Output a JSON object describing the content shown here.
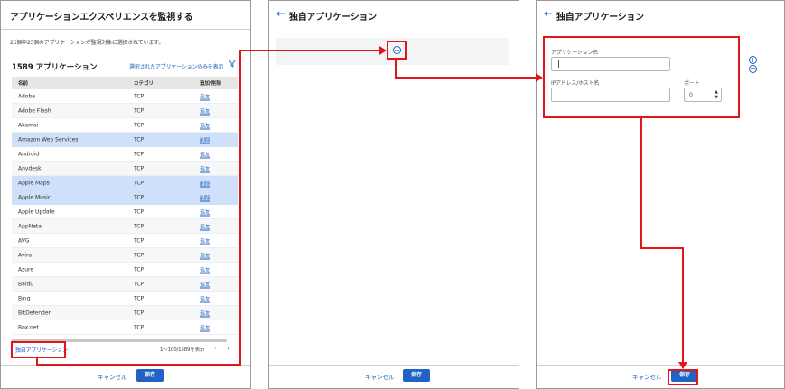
{
  "panel1": {
    "title": "アプリケーションエクスペリエンスを監視する",
    "monitored_note": "25個中23個のアプリケーションが監視対象に選択されています。",
    "app_count": "1589 アプリケーション",
    "show_selected_link": "選択されたアプリケーションのみを表示",
    "filter_icon": "filter-icon",
    "table": {
      "headers": [
        "名前",
        "カテゴリ",
        "追加/削除"
      ],
      "rows": [
        {
          "name": "Adobe",
          "category": "TCP",
          "action": "追加",
          "selected": false
        },
        {
          "name": "Adobe Flash",
          "category": "TCP",
          "action": "追加",
          "selected": false
        },
        {
          "name": "Akamai",
          "category": "TCP",
          "action": "追加",
          "selected": false
        },
        {
          "name": "Amazon Web Services",
          "category": "TCP",
          "action": "削除",
          "selected": true
        },
        {
          "name": "Android",
          "category": "TCP",
          "action": "追加",
          "selected": false
        },
        {
          "name": "Anydesk",
          "category": "TCP",
          "action": "追加",
          "selected": false
        },
        {
          "name": "Apple Maps",
          "category": "TCP",
          "action": "削除",
          "selected": true
        },
        {
          "name": "Apple Music",
          "category": "TCP",
          "action": "削除",
          "selected": true
        },
        {
          "name": "Apple Update",
          "category": "TCP",
          "action": "追加",
          "selected": false
        },
        {
          "name": "AppNeta",
          "category": "TCP",
          "action": "追加",
          "selected": false
        },
        {
          "name": "AVG",
          "category": "TCP",
          "action": "追加",
          "selected": false
        },
        {
          "name": "Avira",
          "category": "TCP",
          "action": "追加",
          "selected": false
        },
        {
          "name": "Azure",
          "category": "TCP",
          "action": "追加",
          "selected": false
        },
        {
          "name": "Baidu",
          "category": "TCP",
          "action": "追加",
          "selected": false
        },
        {
          "name": "Bing",
          "category": "TCP",
          "action": "追加",
          "selected": false
        },
        {
          "name": "BitDefender",
          "category": "TCP",
          "action": "追加",
          "selected": false
        },
        {
          "name": "Box.net",
          "category": "TCP",
          "action": "追加",
          "selected": false
        }
      ]
    },
    "custom_app_link": "独自アプリケーション",
    "pagination": {
      "range": "1～100/1589を表示",
      "prev": "‹",
      "next": "›"
    },
    "cancel": "キャンセル",
    "save": "保存"
  },
  "panel2": {
    "back_icon": "←",
    "title": "独自アプリケーション",
    "add_icon": "+",
    "cancel": "キャンセル",
    "save": "保存"
  },
  "panel3": {
    "back_icon": "←",
    "title": "独自アプリケーション",
    "app_name_label": "アプリケーション名",
    "app_name_value": "",
    "ip_label": "IPアドレス/ホスト名",
    "ip_value": "",
    "port_label": "ポート",
    "port_value": "0",
    "add_icon": "+",
    "remove_icon": "−",
    "cancel": "キャンセル",
    "save": "保存"
  },
  "colors": {
    "accent": "#1f63c6",
    "link": "#1c5fbf",
    "selected_row": "#cfe0fb",
    "annotation": "#e0161a"
  }
}
